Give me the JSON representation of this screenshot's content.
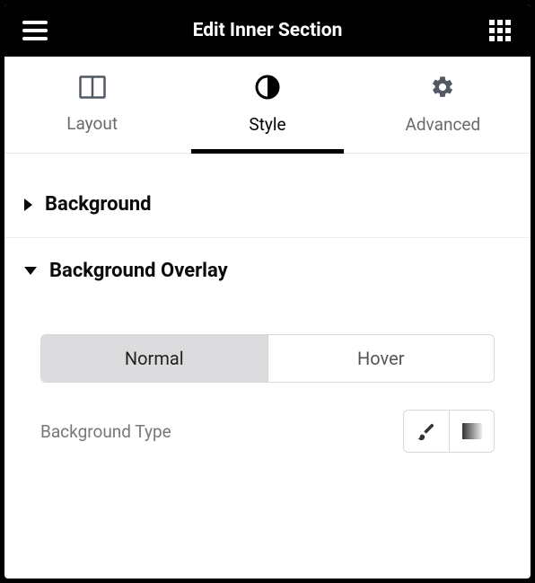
{
  "header": {
    "title": "Edit Inner Section"
  },
  "tabs": {
    "layout": "Layout",
    "style": "Style",
    "advanced": "Advanced"
  },
  "sections": {
    "background": "Background",
    "backgroundOverlay": "Background Overlay"
  },
  "overlay": {
    "normal": "Normal",
    "hover": "Hover",
    "backgroundTypeLabel": "Background Type"
  }
}
